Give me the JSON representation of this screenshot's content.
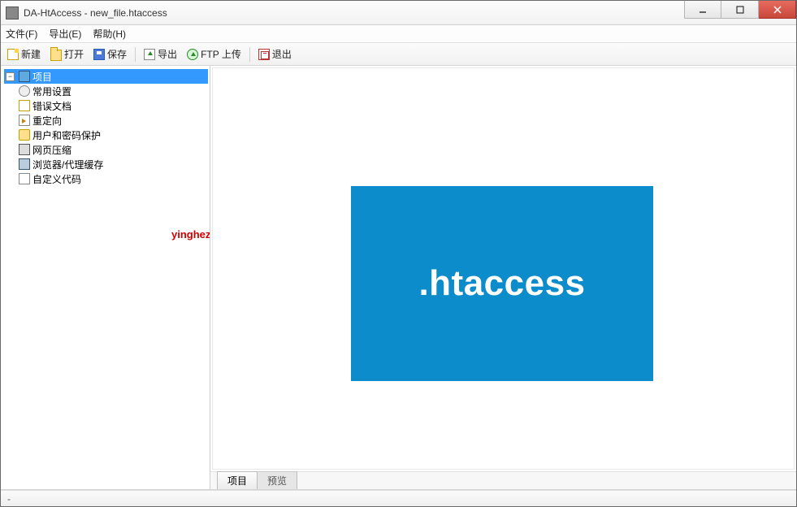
{
  "window": {
    "title": "DA-HtAccess - new_file.htaccess"
  },
  "menubar": [
    "文件(F)",
    "导出(E)",
    "帮助(H)"
  ],
  "toolbar": {
    "new": "新建",
    "open": "打开",
    "save": "保存",
    "export": "导出",
    "ftp": "FTP 上传",
    "exit": "退出"
  },
  "tree": {
    "root": "项目",
    "items": [
      "常用设置",
      "错误文档",
      "重定向",
      "用户和密码保护",
      "网页压缩",
      "浏览器/代理缓存",
      "自定义代码"
    ]
  },
  "logo": {
    "text": ".htaccess",
    "bg": "#0d8ccc"
  },
  "bottom_tabs": [
    "项目",
    "预览"
  ],
  "statusbar": {
    "text": "-"
  },
  "watermark": "yinghezhan.com"
}
